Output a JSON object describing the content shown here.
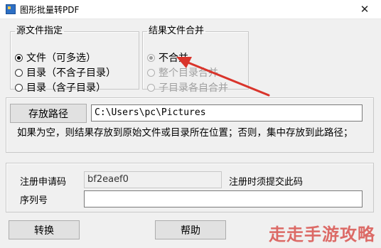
{
  "window": {
    "title": "图形批量转PDF",
    "close_glyph": "✕"
  },
  "source_group": {
    "legend": "源文件指定",
    "options": [
      {
        "label": "文件（可多选）",
        "checked": true
      },
      {
        "label": "目录（不含子目录）",
        "checked": false
      },
      {
        "label": "目录（含子目录）",
        "checked": false
      }
    ]
  },
  "merge_group": {
    "legend": "结果文件合并",
    "options": [
      {
        "label": "不合并",
        "checked": true,
        "disabled": false
      },
      {
        "label": "整个目录合并",
        "checked": false,
        "disabled": true
      },
      {
        "label": "子目录各自合并",
        "checked": false,
        "disabled": true
      }
    ]
  },
  "output": {
    "button_label": "存放路径",
    "path_value": "C:\\Users\\pc\\Pictures",
    "hint": "如果为空，则结果存放到原始文件或目录所在位置；否则，集中存放到此路径；"
  },
  "registration": {
    "code_label": "注册申请码",
    "code_value": "bf2eaef0",
    "code_note": "注册时须提交此码",
    "serial_label": "序列号",
    "serial_value": ""
  },
  "actions": {
    "convert_label": "转换",
    "help_label": "帮助"
  },
  "watermark": "走走手游攻略",
  "colors": {
    "arrow": "#d9342b",
    "window_bg": "#f0f0f0"
  }
}
